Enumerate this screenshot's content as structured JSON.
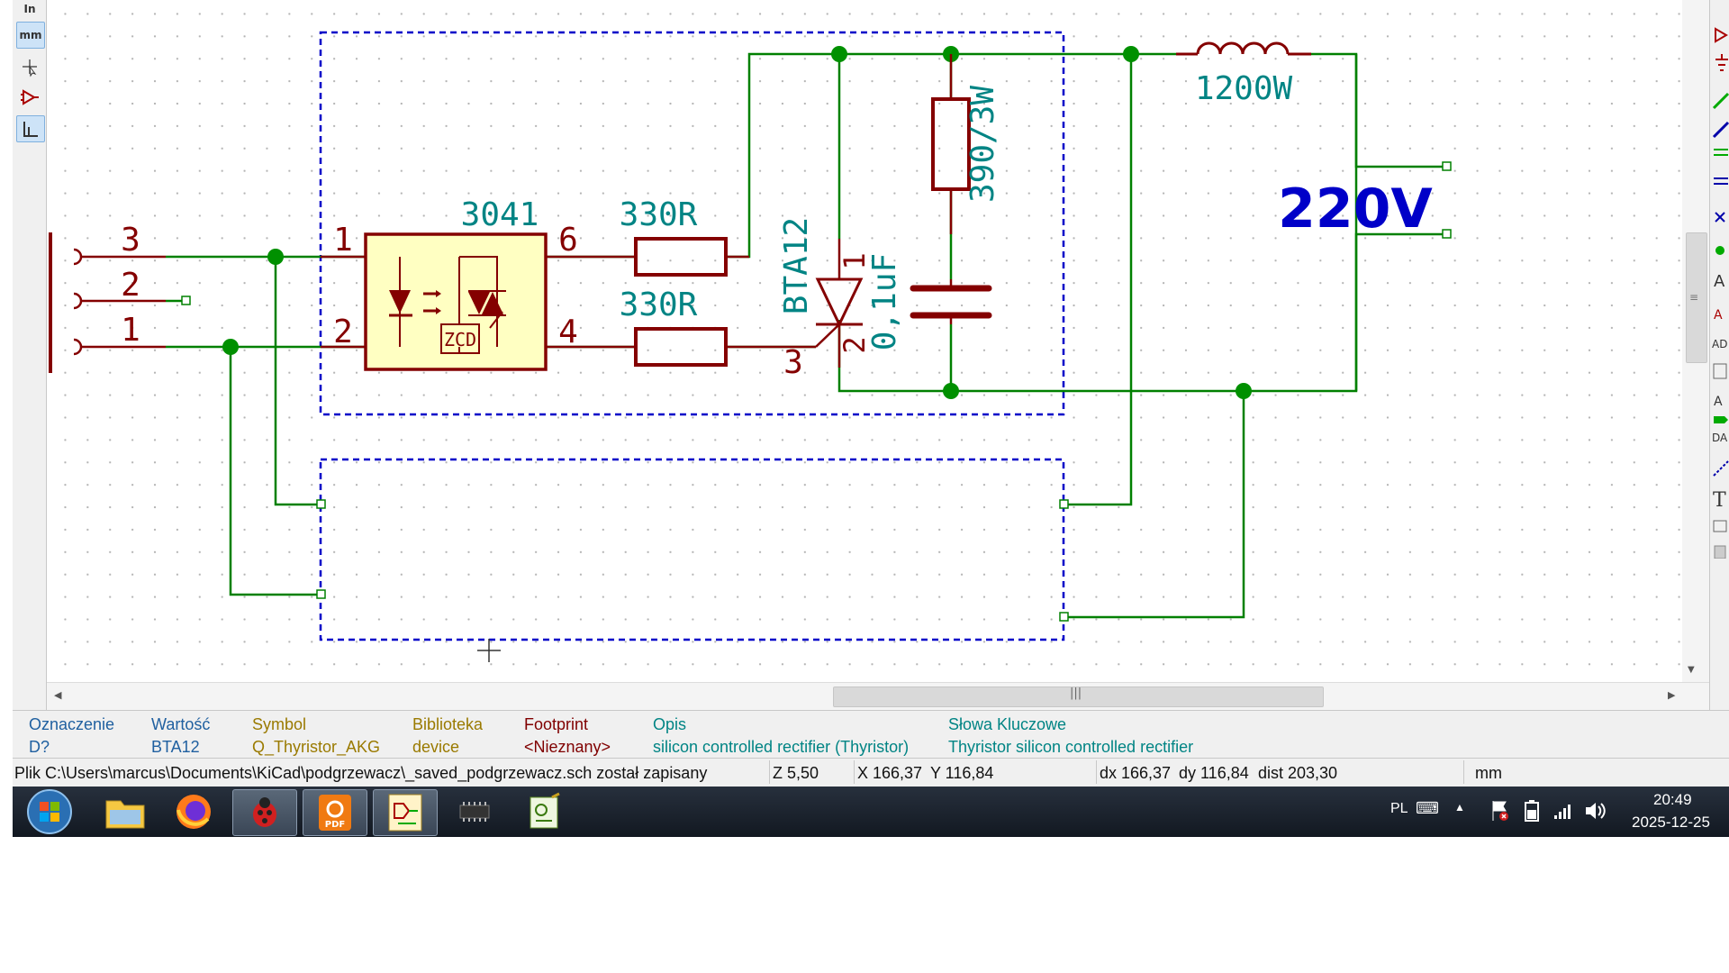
{
  "schematic": {
    "connector_pins": [
      "3",
      "2",
      "1"
    ],
    "optocoupler": {
      "ref": "3041",
      "pin1": "1",
      "pin2": "2",
      "pin6": "6",
      "pin4": "4",
      "zcd": "ZCD"
    },
    "resistor_top": "330R",
    "resistor_bottom": "330R",
    "triac": {
      "ref": "BTA12",
      "pin1": "1",
      "pin2": "2",
      "pin3": "3"
    },
    "snubber_resistor": "390/3W",
    "snubber_cap": "0,1uF",
    "load": "1200W",
    "mains": "220V",
    "colors": {
      "wire": "#008000",
      "component": "#840000",
      "ref_text": "#008484",
      "junction": "#009000",
      "sheet_border": "#0000c8",
      "power_label": "#0000c8",
      "component_fill": "#ffffc2"
    }
  },
  "toolbar": {
    "left_tools": [
      {
        "label": "In",
        "icon": "inch-units-icon"
      },
      {
        "label": "mm",
        "icon": "mm-units-icon"
      },
      {
        "label": "",
        "icon": "cursor-full-icon"
      },
      {
        "label": "",
        "icon": "hidden-pins-icon"
      },
      {
        "label": "",
        "icon": "orthogonal-wire-icon"
      }
    ],
    "right_tools": [
      {
        "label": "",
        "icon": "add-symbol-icon"
      },
      {
        "label": "",
        "icon": "add-power-icon"
      },
      {
        "label": "",
        "icon": "add-wire-icon"
      },
      {
        "label": "",
        "icon": "add-bus-icon"
      },
      {
        "label": "",
        "icon": "wire-to-bus-icon"
      },
      {
        "label": "",
        "icon": "bus-to-bus-icon"
      },
      {
        "label": "",
        "icon": "no-connect-icon"
      },
      {
        "label": "",
        "icon": "junction-icon"
      },
      {
        "label": "A",
        "icon": "net-label-icon"
      },
      {
        "label": "A",
        "icon": "global-label-icon"
      },
      {
        "label": "AD",
        "icon": "hier-label-icon"
      },
      {
        "label": "",
        "icon": "hier-sheet-icon"
      },
      {
        "label": "A",
        "icon": "import-sheet-pin-icon"
      },
      {
        "label": "",
        "icon": "add-sheet-pin-icon"
      },
      {
        "label": "DA",
        "icon": "graphic-line-icon"
      },
      {
        "label": "",
        "icon": "graphic-dashed-icon"
      },
      {
        "label": "T",
        "icon": "add-text-icon"
      },
      {
        "label": "",
        "icon": "add-image-icon"
      },
      {
        "label": "",
        "icon": "delete-icon"
      }
    ]
  },
  "info_panel": {
    "columns": [
      {
        "header": "Oznaczenie",
        "value": "D?"
      },
      {
        "header": "Wartość",
        "value": "BTA12"
      },
      {
        "header": "Symbol",
        "value": "Q_Thyristor_AKG"
      },
      {
        "header": "Biblioteka",
        "value": "device"
      },
      {
        "header": "Footprint",
        "value": "<Nieznany>"
      },
      {
        "header": "Opis",
        "value": "silicon controlled rectifier (Thyristor)"
      },
      {
        "header": "Słowa Kluczowe",
        "value": "Thyristor silicon controlled rectifier"
      }
    ]
  },
  "status_bar": {
    "message": "Plik C:\\Users\\marcus\\Documents\\KiCad\\podgrzewacz\\_saved_podgrzewacz.sch został zapisany",
    "zoom": "Z 5,50",
    "x": "X 166,37",
    "y": "Y 116,84",
    "dx": "dx 166,37",
    "dy": "dy 116,84",
    "dist": "dist 203,30",
    "units": "mm"
  },
  "taskbar": {
    "apps": [
      {
        "name": "start-button",
        "icon": "windows-logo-icon"
      },
      {
        "name": "explorer",
        "icon": "folder-icon"
      },
      {
        "name": "firefox",
        "icon": "firefox-icon"
      },
      {
        "name": "bug-app",
        "icon": "ladybug-icon"
      },
      {
        "name": "pdf-app",
        "icon": "pdf-icon",
        "label": "PDF"
      },
      {
        "name": "eeschema",
        "icon": "schematic-icon"
      },
      {
        "name": "chip-app",
        "icon": "chip-icon"
      },
      {
        "name": "gerber-app",
        "icon": "gerber-icon"
      }
    ],
    "language": "PL",
    "time": "20:49",
    "date": "2025-12-25"
  }
}
